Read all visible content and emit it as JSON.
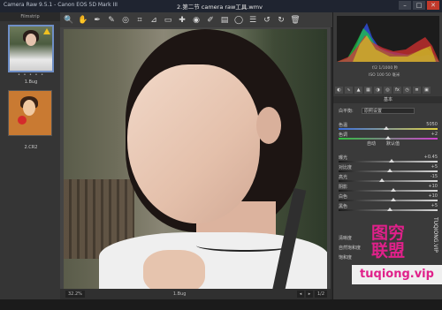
{
  "window": {
    "app_title": "Camera Raw 9.5.1  -  Canon EOS 5D Mark III",
    "doc_title": "2.第二节 camera raw工具.wmv",
    "controls": [
      "–",
      "□",
      "✕"
    ]
  },
  "filmstrip": {
    "header": "Filmstrip",
    "items": [
      {
        "label": "1.Bug",
        "rating": "• • • • •"
      },
      {
        "label": "2.CR2"
      }
    ]
  },
  "toolbar": {
    "tools": [
      {
        "name": "zoom-tool-icon",
        "glyph": "🔍"
      },
      {
        "name": "hand-tool-icon",
        "glyph": "✋"
      },
      {
        "name": "white-balance-tool-icon",
        "glyph": "✒"
      },
      {
        "name": "color-sampler-tool-icon",
        "glyph": "✎"
      },
      {
        "name": "targeted-adjustment-tool-icon",
        "glyph": "◎"
      },
      {
        "name": "crop-tool-icon",
        "glyph": "⌗"
      },
      {
        "name": "straighten-tool-icon",
        "glyph": "⊿"
      },
      {
        "name": "transform-tool-icon",
        "glyph": "▭"
      },
      {
        "name": "spot-removal-tool-icon",
        "glyph": "✚"
      },
      {
        "name": "red-eye-tool-icon",
        "glyph": "◉"
      },
      {
        "name": "adjustment-brush-icon",
        "glyph": "✐"
      },
      {
        "name": "graduated-filter-icon",
        "glyph": "▤"
      },
      {
        "name": "radial-filter-icon",
        "glyph": "◯"
      },
      {
        "name": "preferences-icon",
        "glyph": "☰"
      },
      {
        "name": "rotate-left-icon",
        "glyph": "↺"
      },
      {
        "name": "rotate-right-icon",
        "glyph": "↻"
      },
      {
        "name": "trash-icon",
        "glyph": "🗑"
      }
    ]
  },
  "status": {
    "zoom": "32.2%",
    "filename": "1.Bug",
    "nav_prev": "◂",
    "nav_next": "▸",
    "page": "1/2"
  },
  "panel": {
    "camera_info": {
      "line1": "f/2   1/1000 秒",
      "line2": "ISO 100   50 毫米"
    },
    "section_title": "基本",
    "white_balance_label": "白平衡:",
    "white_balance_value": "原照设置",
    "sliders": [
      {
        "label": "色温",
        "value": "5050",
        "pos": 0.48,
        "track": "temp"
      },
      {
        "label": "色调",
        "value": "+2",
        "pos": 0.5,
        "track": "tint"
      },
      {
        "label": "曝光",
        "value": "+0.45",
        "pos": 0.54,
        "track": "neutral"
      },
      {
        "label": "对比度",
        "value": "+5",
        "pos": 0.52,
        "track": "neutral"
      },
      {
        "label": "高光",
        "value": "-15",
        "pos": 0.44,
        "track": "neutral"
      },
      {
        "label": "阴影",
        "value": "+10",
        "pos": 0.55,
        "track": "neutral"
      },
      {
        "label": "白色",
        "value": "+10",
        "pos": 0.55,
        "track": "neutral"
      },
      {
        "label": "黑色",
        "value": "+5",
        "pos": 0.52,
        "track": "neutral"
      }
    ],
    "auto_label": "自动",
    "default_label": "默认值",
    "extra_items": [
      "清晰度",
      "自然饱和度",
      "饱和度"
    ]
  },
  "watermark": {
    "line1": "图穷",
    "line2": "联盟",
    "vertical": "TUQIONG.VIP",
    "url": "tuqiong.vip"
  },
  "colors": {
    "accent": "#6f8fc7",
    "watermark": "#e0208a"
  }
}
